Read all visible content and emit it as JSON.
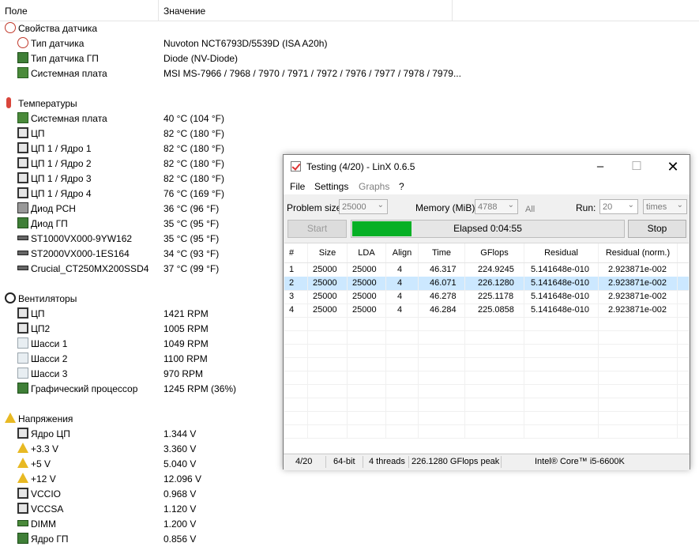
{
  "list": {
    "header": {
      "field": "Поле",
      "value": "Значение"
    },
    "rows": [
      {
        "label": "Свойства датчика",
        "value": "",
        "icon": "gauge-icon",
        "indent": 0
      },
      {
        "label": "Тип датчика",
        "value": "Nuvoton NCT6793D/5539D  (ISA A20h)",
        "icon": "gauge-icon",
        "indent": 1
      },
      {
        "label": "Тип датчика ГП",
        "value": "Diode  (NV-Diode)",
        "icon": "gpu-icon",
        "indent": 1
      },
      {
        "label": "Системная плата",
        "value": "MSI MS-7966 / 7968 / 7970 / 7971 / 7972 / 7976 / 7977 / 7978 / 7979...",
        "icon": "motherboard-icon",
        "indent": 1
      },
      {
        "label": "Температуры",
        "value": "",
        "icon": "thermometer-icon",
        "indent": 0
      },
      {
        "label": "Системная плата",
        "value": "40 °C  (104 °F)",
        "icon": "motherboard-icon",
        "indent": 1
      },
      {
        "label": "ЦП",
        "value": "82 °C  (180 °F)",
        "icon": "cpu-icon",
        "indent": 1
      },
      {
        "label": "ЦП 1 / Ядро 1",
        "value": "82 °C  (180 °F)",
        "icon": "cpu-icon",
        "indent": 1
      },
      {
        "label": "ЦП 1 / Ядро 2",
        "value": "82 °C  (180 °F)",
        "icon": "cpu-icon",
        "indent": 1
      },
      {
        "label": "ЦП 1 / Ядро 3",
        "value": "82 °C  (180 °F)",
        "icon": "cpu-icon",
        "indent": 1
      },
      {
        "label": "ЦП 1 / Ядро 4",
        "value": "76 °C  (169 °F)",
        "icon": "cpu-icon",
        "indent": 1
      },
      {
        "label": "Диод PCH",
        "value": "36 °C  (96 °F)",
        "icon": "chip-icon",
        "indent": 1
      },
      {
        "label": "Диод ГП",
        "value": "35 °C  (95 °F)",
        "icon": "gpu-icon",
        "indent": 1
      },
      {
        "label": "ST1000VX000-9YW162",
        "value": "35 °C  (95 °F)",
        "icon": "disk-icon",
        "indent": 1
      },
      {
        "label": "ST2000VX000-1ES164",
        "value": "34 °C  (93 °F)",
        "icon": "disk-icon",
        "indent": 1
      },
      {
        "label": "Crucial_CT250MX200SSD4",
        "value": "37 °C  (99 °F)",
        "icon": "disk-icon",
        "indent": 1
      },
      {
        "label": "Вентиляторы",
        "value": "",
        "icon": "fan-icon",
        "indent": 0
      },
      {
        "label": "ЦП",
        "value": "1421 RPM",
        "icon": "cpu-icon",
        "indent": 1
      },
      {
        "label": "ЦП2",
        "value": "1005 RPM",
        "icon": "cpu-icon",
        "indent": 1
      },
      {
        "label": "Шасси 1",
        "value": "1049 RPM",
        "icon": "case-icon",
        "indent": 1
      },
      {
        "label": "Шасси 2",
        "value": "1100 RPM",
        "icon": "case-icon",
        "indent": 1
      },
      {
        "label": "Шасси 3",
        "value": "970 RPM",
        "icon": "case-icon",
        "indent": 1
      },
      {
        "label": "Графический процессор",
        "value": "1245 RPM  (36%)",
        "icon": "gpu-icon",
        "indent": 1
      },
      {
        "label": "Напряжения",
        "value": "",
        "icon": "warning-icon",
        "indent": 0
      },
      {
        "label": "Ядро ЦП",
        "value": "1.344 V",
        "icon": "cpu-icon",
        "indent": 1
      },
      {
        "label": "+3.3 V",
        "value": "3.360 V",
        "icon": "warning-icon",
        "indent": 1
      },
      {
        "label": "+5 V",
        "value": "5.040 V",
        "icon": "warning-icon",
        "indent": 1
      },
      {
        "label": "+12 V",
        "value": "12.096 V",
        "icon": "warning-icon",
        "indent": 1
      },
      {
        "label": "VCCIO",
        "value": "0.968 V",
        "icon": "cpu-icon",
        "indent": 1
      },
      {
        "label": "VCCSA",
        "value": "1.120 V",
        "icon": "cpu-icon",
        "indent": 1
      },
      {
        "label": "DIMM",
        "value": "1.200 V",
        "icon": "dimm-icon",
        "indent": 1
      },
      {
        "label": "Ядро ГП",
        "value": "0.856 V",
        "icon": "gpu-icon",
        "indent": 1
      }
    ]
  },
  "linx": {
    "title": "Testing (4/20) - LinX 0.6.5",
    "menu": [
      "File",
      "Settings",
      "Graphs",
      "?"
    ],
    "problem_size_label": "Problem size:",
    "problem_size": "25000",
    "memory_label": "Memory (MiB):",
    "memory": "4788",
    "all_label": "All",
    "run_label": "Run:",
    "run": "20",
    "run_unit": "times",
    "start_label": "Start",
    "stop_label": "Stop",
    "progress_text": "Elapsed 0:04:55",
    "progress_fraction": 0.22,
    "progress_color": "#06b025",
    "columns": [
      "#",
      "Size",
      "LDA",
      "Align",
      "Time",
      "GFlops",
      "Residual",
      "Residual (norm.)"
    ],
    "rows": [
      [
        "1",
        "25000",
        "25000",
        "4",
        "46.317",
        "224.9245",
        "5.141648e-010",
        "2.923871e-002"
      ],
      [
        "2",
        "25000",
        "25000",
        "4",
        "46.071",
        "226.1280",
        "5.141648e-010",
        "2.923871e-002"
      ],
      [
        "3",
        "25000",
        "25000",
        "4",
        "46.278",
        "225.1178",
        "5.141648e-010",
        "2.923871e-002"
      ],
      [
        "4",
        "25000",
        "25000",
        "4",
        "46.284",
        "225.0858",
        "5.141648e-010",
        "2.923871e-002"
      ]
    ],
    "selected_row": 1,
    "status": [
      "4/20",
      "64-bit",
      "4 threads",
      "226.1280 GFlops peak",
      "Intel® Core™ i5-6600K"
    ]
  }
}
